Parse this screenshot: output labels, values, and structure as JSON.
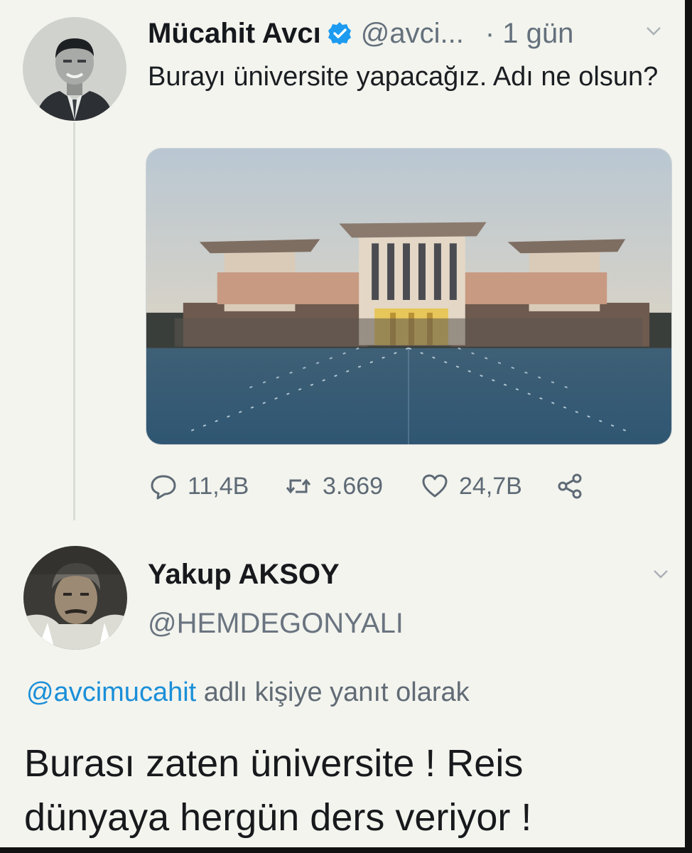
{
  "tweet": {
    "author_name": "Mücahit Avcı",
    "author_handle": "@avci...",
    "time": "· 1 gün",
    "text": "Burayı üniversite yapacağız. Adı ne olsun?",
    "stats": {
      "replies": "11,4B",
      "retweets": "3.669",
      "likes": "24,7B"
    },
    "icons": {
      "verified": "verified-badge-icon",
      "reply": "reply-icon",
      "retweet": "retweet-icon",
      "like": "heart-icon",
      "share": "share-icon",
      "menu": "chevron-down-icon"
    }
  },
  "reply": {
    "author_name": "Yakup AKSOY",
    "author_handle": "@HEMDEGONYALI",
    "replying_to_mention": "@avcimucahit",
    "replying_to_suffix": " adlı kişiye yanıt olarak",
    "text": "Burası zaten üniversite ! Reis dünyaya hergün ders veriyor !"
  },
  "colors": {
    "background": "#f3f4ee",
    "link": "#1a8fd8",
    "secondary_text": "#64707c",
    "verified": "#1d9bf0"
  }
}
